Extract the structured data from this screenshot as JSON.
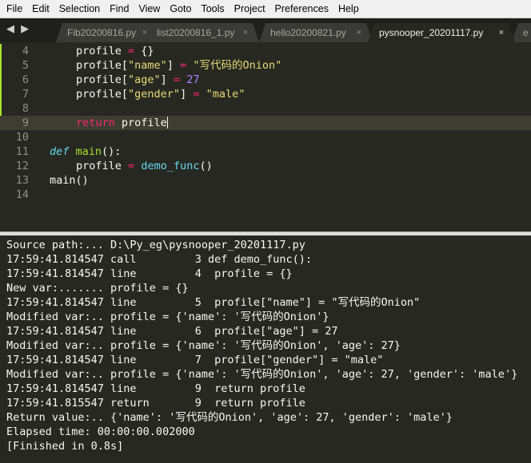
{
  "menu": [
    "File",
    "Edit",
    "Selection",
    "Find",
    "View",
    "Goto",
    "Tools",
    "Project",
    "Preferences",
    "Help"
  ],
  "nav_arrows": "◀ ▶",
  "tabs": [
    {
      "label": "Fib20200816.py",
      "close": "×"
    },
    {
      "label": "list20200816_1.py",
      "close": "×"
    },
    {
      "label": "hello20200821.py",
      "close": "×"
    },
    {
      "label": "pysnooper_20201117.py",
      "close": "×",
      "active": true
    },
    {
      "label": "e",
      "close": ""
    }
  ],
  "editor": {
    "line_numbers": [
      "4",
      "5",
      "6",
      "7",
      "8",
      "9",
      "10",
      "11",
      "12",
      "13",
      "14"
    ],
    "code": {
      "l4": {
        "a": "profile ",
        "b": "=",
        "c": " {}"
      },
      "l5": {
        "a": "profile[",
        "b": "\"name\"",
        "c": "] ",
        "d": "=",
        "e": " ",
        "f": "\"写代码的Onion\""
      },
      "l6": {
        "a": "profile[",
        "b": "\"age\"",
        "c": "] ",
        "d": "=",
        "e": " ",
        "f": "27"
      },
      "l7": {
        "a": "profile[",
        "b": "\"gender\"",
        "c": "] ",
        "d": "=",
        "e": " ",
        "f": "\"male\""
      },
      "l9": {
        "a": "return",
        "b": " profile"
      },
      "l11": {
        "a": "def",
        "b": " ",
        "c": "main",
        "d": "():"
      },
      "l12": {
        "a": "profile ",
        "b": "=",
        "c": " ",
        "d": "demo_func",
        "e": "()"
      },
      "l13": {
        "a": "main",
        "b": "()"
      }
    }
  },
  "console": {
    "lines": [
      "Source path:... D:\\Py_eg\\pysnooper_20201117.py",
      "17:59:41.814547 call         3 def demo_func():",
      "17:59:41.814547 line         4  profile = {}",
      "New var:....... profile = {}",
      "17:59:41.814547 line         5  profile[\"name\"] = \"写代码的Onion\"",
      "Modified var:.. profile = {'name': '写代码的Onion'}",
      "17:59:41.814547 line         6  profile[\"age\"] = 27",
      "Modified var:.. profile = {'name': '写代码的Onion', 'age': 27}",
      "17:59:41.814547 line         7  profile[\"gender\"] = \"male\"",
      "Modified var:.. profile = {'name': '写代码的Onion', 'age': 27, 'gender': 'male'}",
      "17:59:41.814547 line         9  return profile",
      "17:59:41.815547 return       9  return profile",
      "Return value:.. {'name': '写代码的Onion', 'age': 27, 'gender': 'male'}",
      "Elapsed time: 00:00:00.002000",
      "[Finished in 0.8s]"
    ]
  },
  "colors": {
    "background": "#272822",
    "keyword": "#f92672",
    "string": "#e6db74",
    "number": "#ae81ff",
    "function": "#a6e22e",
    "def": "#66d9ef"
  }
}
